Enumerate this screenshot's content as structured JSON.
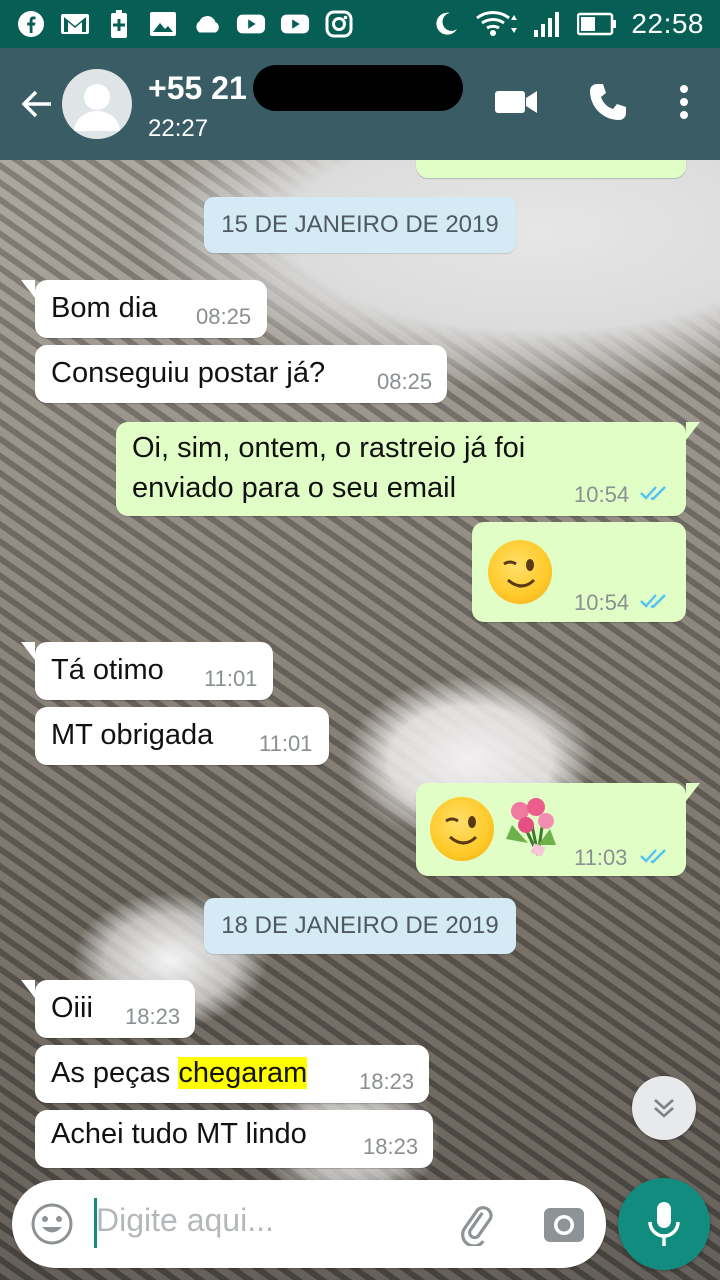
{
  "status_bar": {
    "time": "22:58",
    "left_icons": [
      "facebook-icon",
      "gmail-icon",
      "battery-plus-icon",
      "gallery-icon",
      "cloud-icon",
      "youtube-icon",
      "youtube-icon",
      "instagram-icon"
    ],
    "right_icons": [
      "moon-icon",
      "wifi-icon",
      "signal-icon",
      "battery-icon"
    ]
  },
  "header": {
    "contact_name": "+55 21",
    "last_seen": "22:27"
  },
  "messages": [
    {
      "text": "Bom dia",
      "time": "08:25",
      "dir": "in"
    },
    {
      "text": "Conseguiu postar já?",
      "time": "08:25",
      "dir": "in"
    },
    {
      "line1": "Oi, sim, ontem, o rastreio já foi",
      "line2": "enviado para o seu email",
      "time": "10:54",
      "dir": "out"
    },
    {
      "emoji": "winking-face",
      "time": "10:54",
      "dir": "out"
    },
    {
      "text": "Tá otimo",
      "time": "11:01",
      "dir": "in"
    },
    {
      "text": "MT obrigada",
      "time": "11:01",
      "dir": "in"
    },
    {
      "emoji": "winking-face-and-bouquet",
      "time": "11:03",
      "dir": "out"
    },
    {
      "text": "Oiii",
      "time": "18:23",
      "dir": "in"
    },
    {
      "text_before": "As peças ",
      "text_highlight": "chegaram",
      "time": "18:23",
      "dir": "in"
    },
    {
      "text": "Achei tudo MT lindo",
      "time": "18:23",
      "dir": "in"
    }
  ],
  "date_chips": [
    "15 DE JANEIRO DE 2019",
    "18 DE JANEIRO DE 2019"
  ],
  "composer": {
    "placeholder": "Digite aqui..."
  },
  "colors": {
    "app_bar": "#395c65",
    "status_bar": "#075e54",
    "outgoing_bubble": "#e1fec6",
    "incoming_bubble": "#ffffff",
    "date_chip": "#d4eaf4",
    "mic_button": "#128c7e",
    "read_ticks": "#4fc3f7",
    "highlight": "#ffff00"
  }
}
